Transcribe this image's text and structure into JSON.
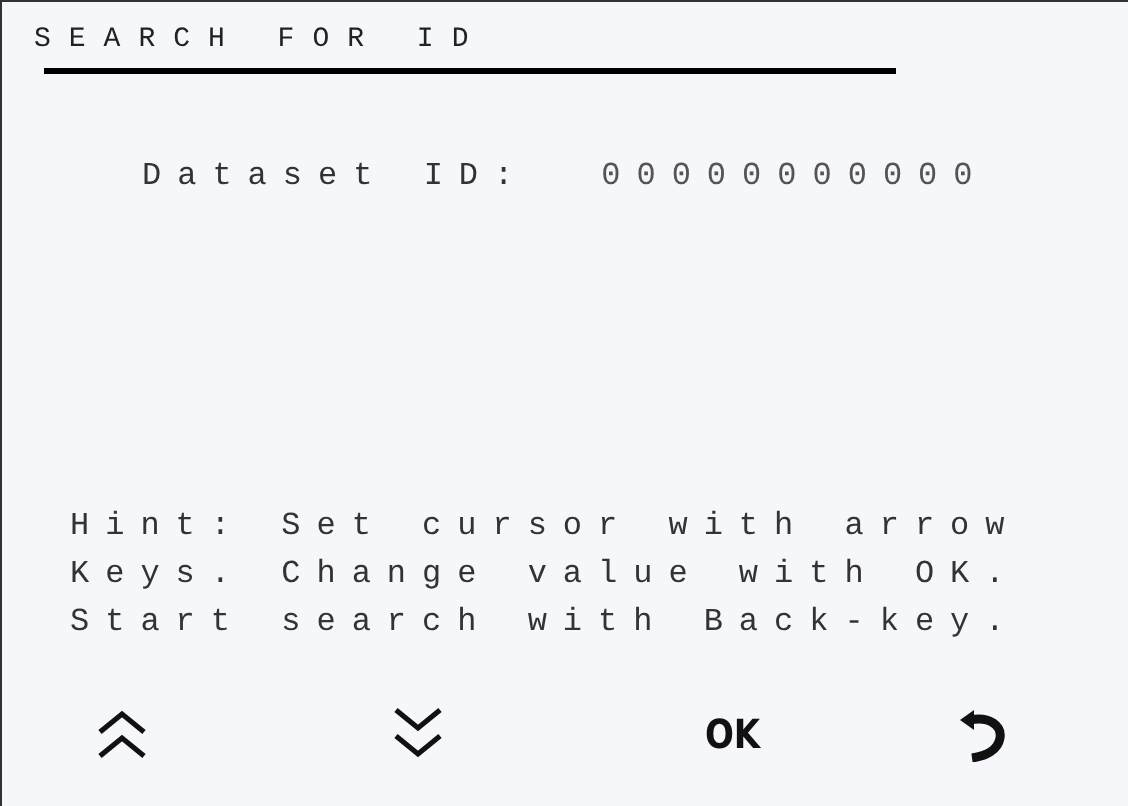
{
  "title": "SEARCH FOR ID",
  "field": {
    "label": "Dataset ID:",
    "value": "00000000000"
  },
  "hint": [
    "Hint: Set cursor with arrow",
    "Keys. Change value with OK.",
    "Start search with Back-key."
  ],
  "buttons": [
    {
      "kind": "up"
    },
    {
      "kind": "down"
    },
    {
      "kind": "text",
      "label": "OK"
    },
    {
      "kind": "back"
    }
  ]
}
